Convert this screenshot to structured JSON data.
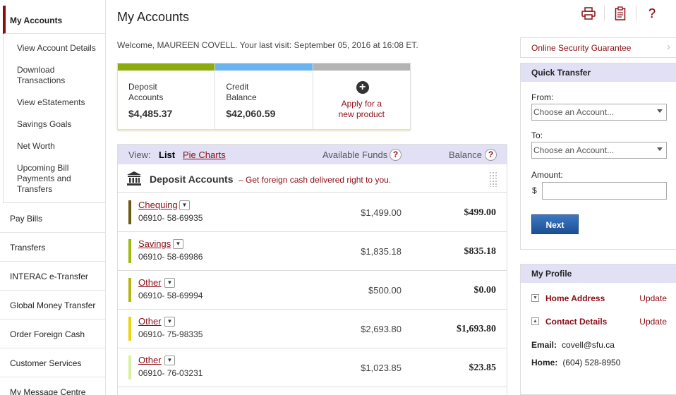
{
  "sidebar": {
    "active": "My Accounts",
    "sub_items": [
      {
        "label_lines": [
          "View Account Details"
        ]
      },
      {
        "label_lines": [
          "Download",
          "Transactions"
        ]
      },
      {
        "label_lines": [
          "View eStatements"
        ]
      },
      {
        "label_lines": [
          "Savings Goals"
        ]
      },
      {
        "label_lines": [
          "Net Worth"
        ]
      },
      {
        "label_lines": [
          "Upcoming Bill",
          "Payments and",
          "Transfers"
        ]
      }
    ],
    "main_items": [
      "Pay Bills",
      "Transfers",
      "INTERAC e-Transfer",
      "Global Money Transfer",
      "Order Foreign Cash",
      "Customer Services",
      "My Message Centre"
    ]
  },
  "header": {
    "title": "My Accounts",
    "icons": [
      "printer-icon",
      "notepad-icon",
      "help-icon"
    ],
    "welcome": "Welcome, MAUREEN COVELL. Your last visit: September 05, 2016 at 16:08 ET."
  },
  "cards": [
    {
      "label_lines": [
        "Deposit",
        "Accounts"
      ],
      "amount": "$4,485.37",
      "color": "#8cab0f"
    },
    {
      "label_lines": [
        "Credit",
        "Balance"
      ],
      "amount": "$42,060.59",
      "color": "#6cb4f0"
    },
    {
      "apply_lines": [
        "Apply for a",
        "new product"
      ],
      "color": "#b3b3b3"
    }
  ],
  "accounts_view": {
    "view_label": "View:",
    "list_label": "List",
    "pie_label": "Pie Charts",
    "available_label": "Available Funds",
    "balance_label": "Balance",
    "section_title": "Deposit Accounts",
    "section_promo": "– Get foreign cash delivered right to you.",
    "rows": [
      {
        "name": "Chequing",
        "number": "06910- 58-69935",
        "available": "$1,499.00",
        "balance": "$499.00",
        "color": "#6b5a12"
      },
      {
        "name": "Savings",
        "number": "06910- 58-69986",
        "available": "$1,835.18",
        "balance": "$835.18",
        "color": "#9cbb0f"
      },
      {
        "name": "Other",
        "number": "06910- 58-69994",
        "available": "$500.00",
        "balance": "$0.00",
        "color": "#b8b40f"
      },
      {
        "name": "Other",
        "number": "06910- 75-98335",
        "available": "$2,693.80",
        "balance": "$1,693.80",
        "color": "#e8d40f"
      },
      {
        "name": "Other",
        "number": "06910- 76-03231",
        "available": "$1,023.85",
        "balance": "$23.85",
        "color": "#d8f0a0"
      }
    ]
  },
  "security": {
    "label": "Online Security Guarantee"
  },
  "quick_transfer": {
    "title": "Quick Transfer",
    "from_label": "From:",
    "to_label": "To:",
    "amount_label": "Amount:",
    "currency": "$",
    "select_placeholder": "Choose an Account...",
    "next_label": "Next"
  },
  "profile": {
    "title": "My Profile",
    "home_address": "Home Address",
    "contact_details": "Contact Details",
    "update_label": "Update",
    "email_label": "Email:",
    "email": "covell@sfu.ca",
    "home_label": "Home:",
    "home_phone": "(604) 528-8950"
  },
  "colors": {
    "brand": "#8b0d14",
    "panel_header": "#e2e0f5",
    "button": "#2a5ea8"
  }
}
